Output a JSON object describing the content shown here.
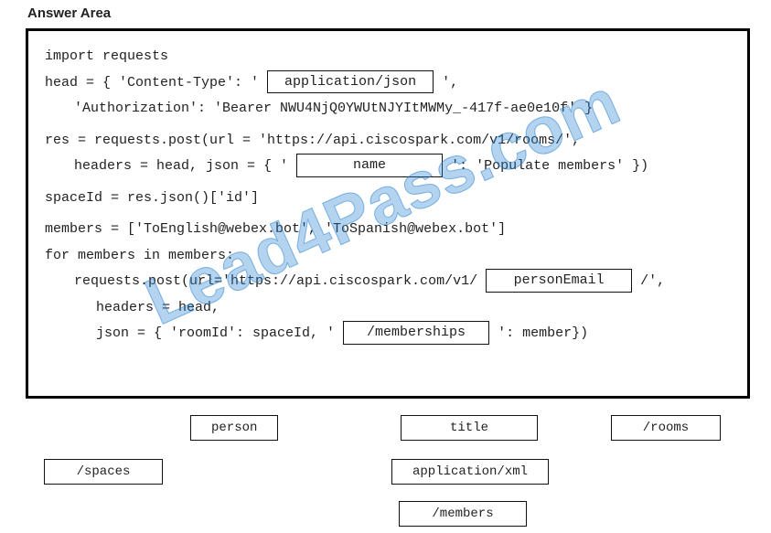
{
  "title": "Answer Area",
  "watermark": "Lead4Pass.com",
  "code": {
    "l1": "import requests",
    "l2a": "head = { 'Content-Type': ' ",
    "slot1": "application/json",
    "l2b": " ',",
    "l3": "'Authorization': 'Bearer NWU4NjQ0YWUtNJYItMWMy_-417f-ae0e10f' }",
    "l4": "res = requests.post(url = 'https://api.ciscospark.com/v1/rooms/',",
    "l5a": "headers = head, json = { ' ",
    "slot2": "name",
    "l5b": " ': 'Populate members' })",
    "l6": "spaceId = res.json()['id']",
    "l7": "members = ['ToEnglish@webex.bot', 'ToSpanish@webex.bot']",
    "l8": "for members in members:",
    "l9a": "requests.post(url='https://api.ciscospark.com/v1/ ",
    "slot3": "personEmail",
    "l9b": " /',",
    "l10": "headers = head,",
    "l11a": "json = { 'roomId': spaceId, ' ",
    "slot4": "/memberships",
    "l11b": " ': member})"
  },
  "pool": {
    "p1": "person",
    "p2": "title",
    "p3": "/rooms",
    "p4": "/spaces",
    "p5": "application/xml",
    "p6": "/members"
  }
}
